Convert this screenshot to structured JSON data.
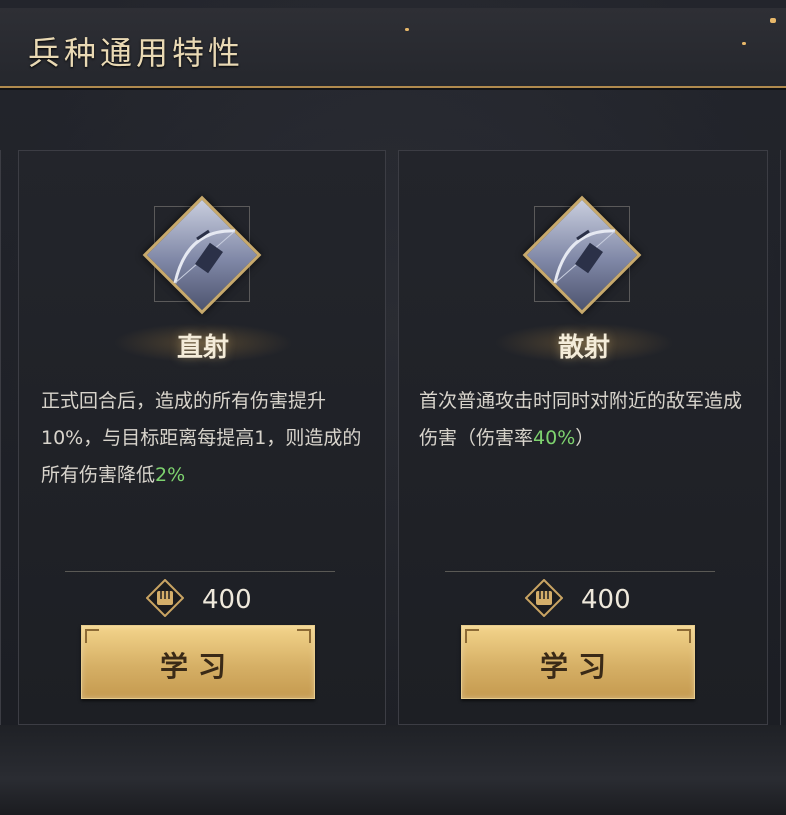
{
  "header": {
    "title": "兵种通用特性"
  },
  "skills": [
    {
      "name": "直射",
      "description_parts": [
        "正式回合后，造成的所有伤害提升10%，与目标距离每提高1，则造成的所有伤害降低",
        "2%"
      ],
      "cost": "400",
      "button_label": "学习"
    },
    {
      "name": "散射",
      "description_parts": [
        "首次普通攻击时同时对附近的敌军造成伤害（伤害率",
        "40%",
        "）"
      ],
      "cost": "400",
      "button_label": "学习"
    }
  ],
  "colors": {
    "accent_gold": "#d6b066",
    "highlight_green": "#7ed36f",
    "text_light": "#d8d4cc"
  },
  "icons": {
    "skill_icon": "bow-icon",
    "cost_icon": "fist-icon"
  }
}
